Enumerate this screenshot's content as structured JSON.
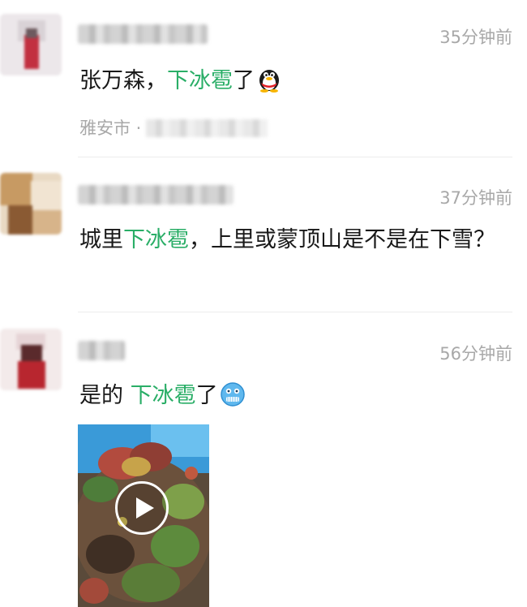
{
  "comments": [
    {
      "time": "35分钟前",
      "text_before": "张万森，",
      "text_highlight": "下冰雹",
      "text_after": "了",
      "emoji": "qq-penguin-icon",
      "location_prefix": "雅安市 ·"
    },
    {
      "time": "37分钟前",
      "text_before": "城里",
      "text_highlight": "下冰雹",
      "text_after": "，上里或蒙顶山是不是在下雪？"
    },
    {
      "time": "56分钟前",
      "text_before": "是的 ",
      "text_highlight": "下冰雹",
      "text_after": "了",
      "emoji": "freezing-face-icon",
      "attachment": "video"
    }
  ],
  "colors": {
    "highlight": "#2aae67",
    "meta_text": "#a8a8a8",
    "body_text": "#191919"
  }
}
